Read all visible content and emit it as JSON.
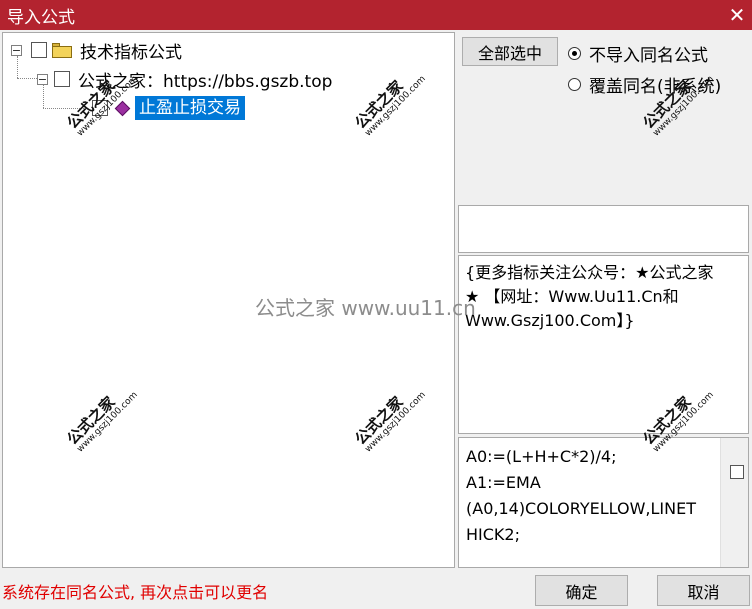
{
  "window": {
    "title": "导入公式",
    "close_glyph": "✕"
  },
  "tree": {
    "root_expander": "−",
    "root_label": "技术指标公式",
    "child_expander": "−",
    "child_label": "公式之家：https://bbs.gszb.top",
    "leaf_label": "止盈止损交易"
  },
  "controls": {
    "select_all_label": "全部选中",
    "radio_skip_label": "不导入同名公式",
    "radio_overwrite_label": "覆盖同名(非系统)",
    "radio_selected": "skip"
  },
  "description_text": "{更多指标关注公众号：★公式之家★ 【网址：Www.Uu11.Cn和Www.Gszj100.Com】}",
  "code_lines": [
    "A0:=(L+H+C*2)/4;",
    "A1:=EMA",
    "(A0,14)COLORYELLOW,LINET",
    "HICK2;"
  ],
  "status_message": "系统存在同名公式, 再次点击可以更名",
  "buttons": {
    "ok_label": "确定",
    "cancel_label": "取消"
  },
  "watermarks": {
    "main": "公式之家",
    "sub": "www.gszj100.com",
    "center": "公式之家 www.uu11.cn"
  },
  "colors": {
    "titlebar": "#b3232f",
    "selection": "#0078d7",
    "status_text": "#e00000"
  }
}
